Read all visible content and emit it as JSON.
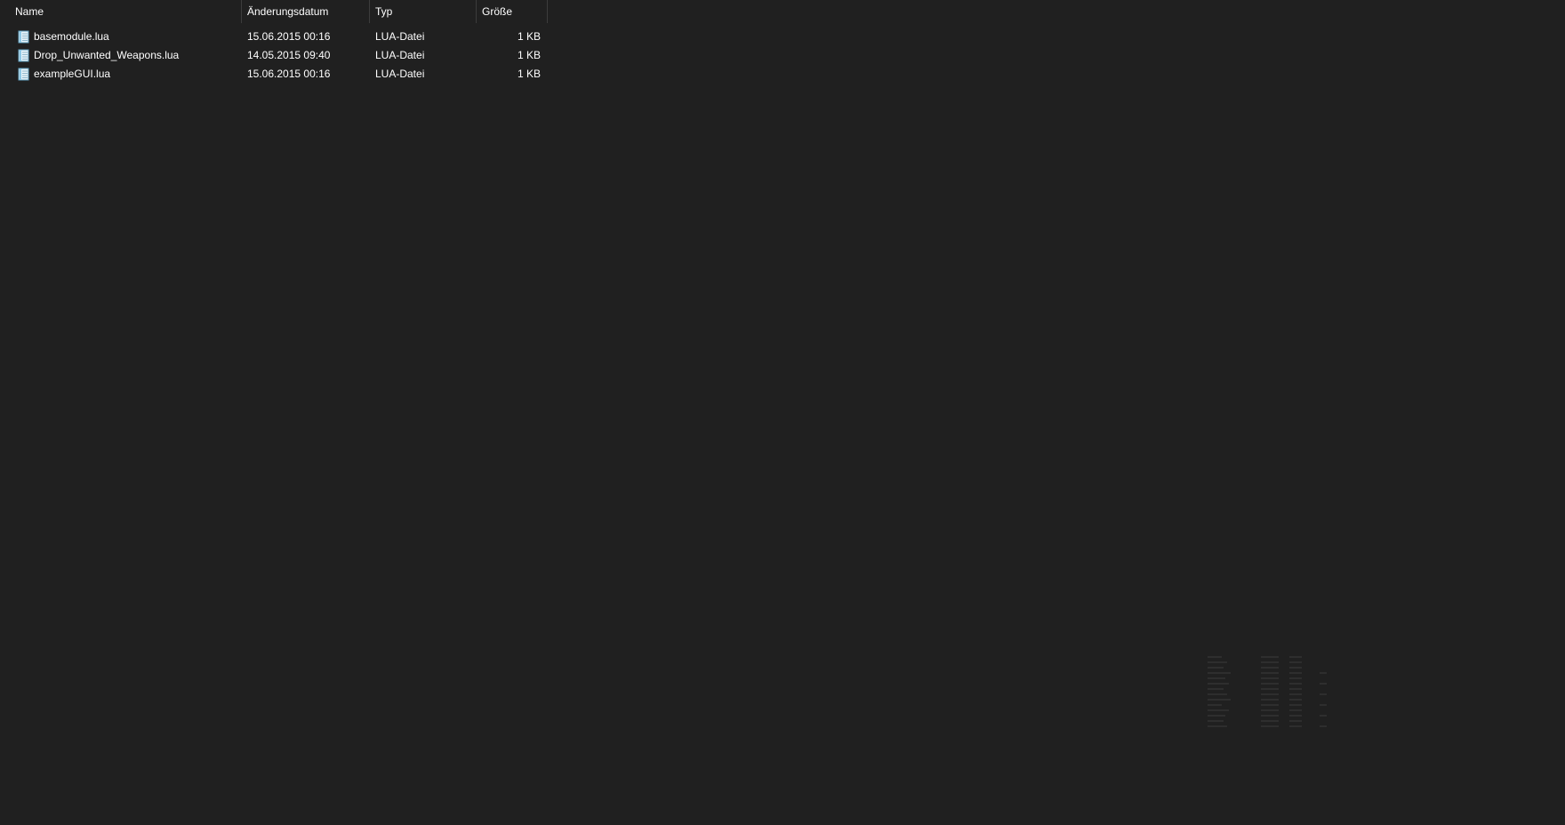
{
  "columns": {
    "name": "Name",
    "date": "Änderungsdatum",
    "type": "Typ",
    "size": "Größe"
  },
  "sort": {
    "icon": "chevron-up-icon",
    "glyph": "^"
  },
  "files": [
    {
      "name": "basemodule.lua",
      "date": "15.06.2015 00:16",
      "type": "LUA-Datei",
      "size": "1 KB",
      "icon": "lua-file-icon"
    },
    {
      "name": "Drop_Unwanted_Weapons.lua",
      "date": "14.05.2015 09:40",
      "type": "LUA-Datei",
      "size": "1 KB",
      "icon": "lua-file-icon"
    },
    {
      "name": "exampleGUI.lua",
      "date": "15.06.2015 00:16",
      "type": "LUA-Datei",
      "size": "1 KB",
      "icon": "lua-file-icon"
    }
  ],
  "colors": {
    "background": "#202020",
    "text": "#ffffff",
    "divider": "#3c3c3c",
    "icon_accent": "#8ec9e6"
  }
}
